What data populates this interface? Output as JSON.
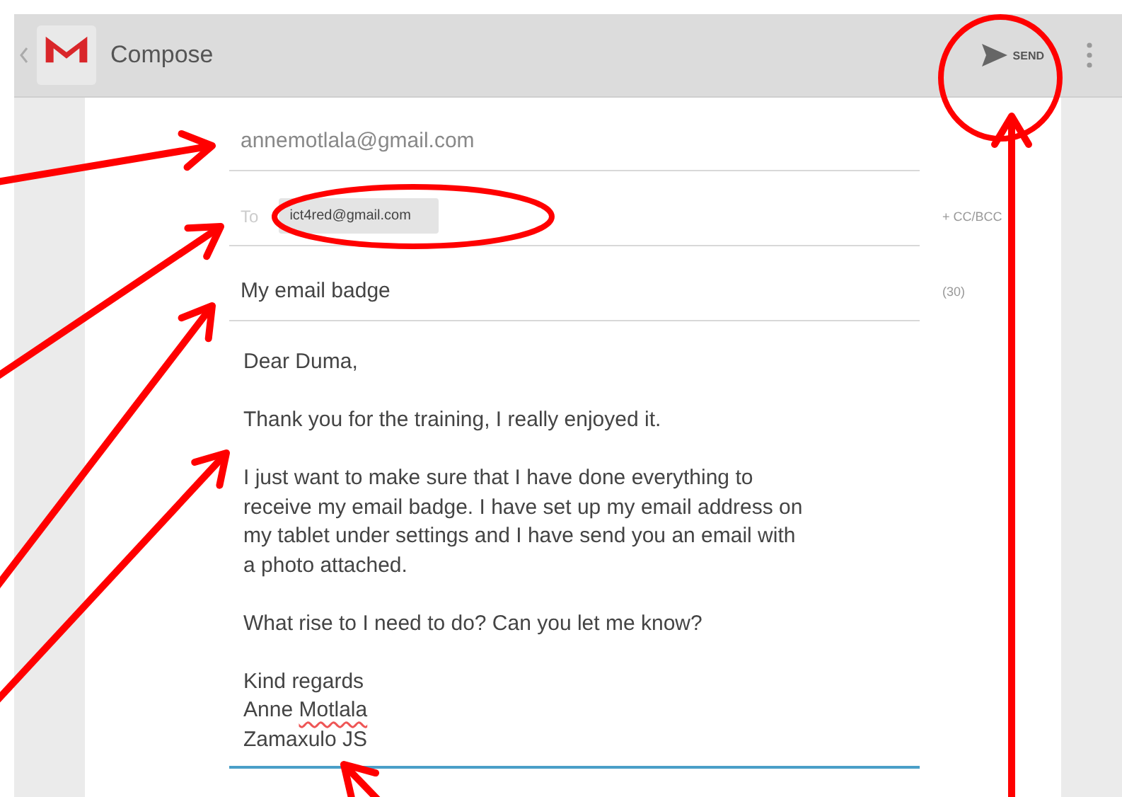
{
  "action_bar": {
    "title": "Compose",
    "send_label": "SEND"
  },
  "compose": {
    "from": "annemotlala@gmail.com",
    "to_label": "To",
    "recipients": [
      "ict4red@gmail.com"
    ],
    "cc_bcc": "+ CC/BCC",
    "subject": "My email badge",
    "subject_counter": "(30)",
    "body": [
      {
        "lines": [
          {
            "parts": [
              {
                "text": "Dear Duma,",
                "misspelled": false
              }
            ]
          }
        ]
      },
      {
        "lines": [
          {
            "parts": [
              {
                "text": "Thank you for the training, I really enjoyed it.",
                "misspelled": false
              }
            ]
          }
        ]
      },
      {
        "lines": [
          {
            "parts": [
              {
                "text": "I just want to make sure that I have done everything to",
                "misspelled": false
              }
            ]
          },
          {
            "parts": [
              {
                "text": "receive my email badge. I have set up my email address on",
                "misspelled": false
              }
            ]
          },
          {
            "parts": [
              {
                "text": "my tablet under settings and I have send you an email with",
                "misspelled": false
              }
            ]
          },
          {
            "parts": [
              {
                "text": "a photo attached.",
                "misspelled": false
              }
            ]
          }
        ]
      },
      {
        "lines": [
          {
            "parts": [
              {
                "text": "What rise to I need to do? Can you let me know?",
                "misspelled": false
              }
            ]
          }
        ]
      },
      {
        "lines": [
          {
            "parts": [
              {
                "text": "Kind regards",
                "misspelled": false
              }
            ]
          },
          {
            "parts": [
              {
                "text": "Anne",
                "misspelled": false
              },
              {
                "text": "Motlala",
                "misspelled": true
              }
            ]
          },
          {
            "parts": [
              {
                "text": "Zamaxulo JS",
                "misspelled": false
              }
            ]
          }
        ]
      }
    ]
  }
}
